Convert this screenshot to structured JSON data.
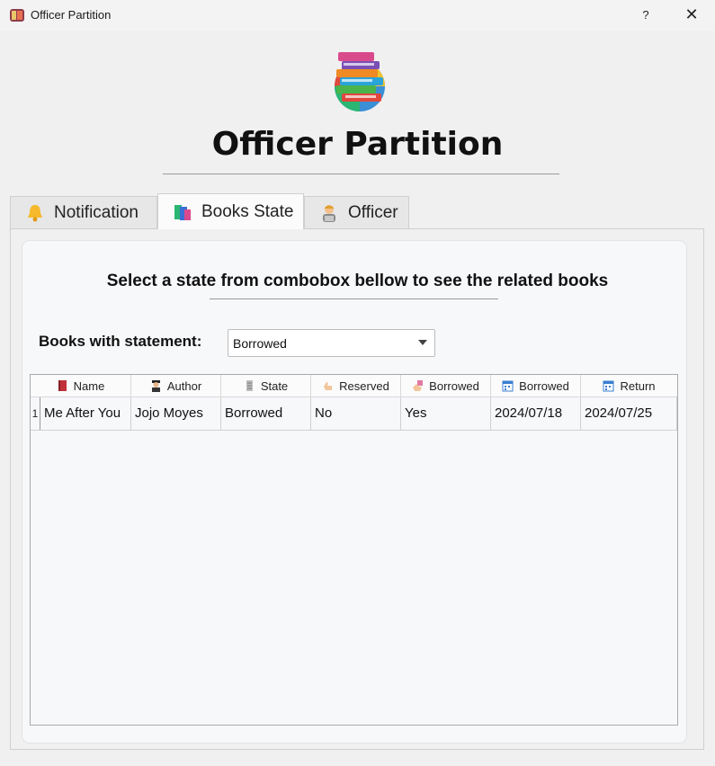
{
  "window": {
    "title": "Officer Partition",
    "help_label": "?",
    "close_label": "✕"
  },
  "header": {
    "title": "Officer Partition",
    "logo_icon": "books-stack-icon"
  },
  "tabs": [
    {
      "label": "Notification",
      "icon": "bell-icon",
      "active": false
    },
    {
      "label": "Books State",
      "icon": "books-icon",
      "active": true
    },
    {
      "label": "Officer",
      "icon": "officer-icon",
      "active": false
    }
  ],
  "books_state": {
    "instruction": "Select a state from combobox bellow to see the related books",
    "filter_label": "Books with statement:",
    "filter_value": "Borrowed",
    "columns": [
      {
        "label": "Name",
        "icon": "red-book-icon"
      },
      {
        "label": "Author",
        "icon": "author-icon"
      },
      {
        "label": "State",
        "icon": "scroll-icon"
      },
      {
        "label": "Reserved",
        "icon": "hand-icon"
      },
      {
        "label": "Borrowed",
        "icon": "hand-book-icon"
      },
      {
        "label": "Borrowed",
        "icon": "calendar-icon"
      },
      {
        "label": "Return",
        "icon": "calendar-icon"
      }
    ],
    "rows": [
      {
        "num": "1",
        "cells": [
          "Me After You",
          "Jojo Moyes",
          "Borrowed",
          "No",
          "Yes",
          "2024/07/18",
          "2024/07/25"
        ]
      }
    ]
  }
}
